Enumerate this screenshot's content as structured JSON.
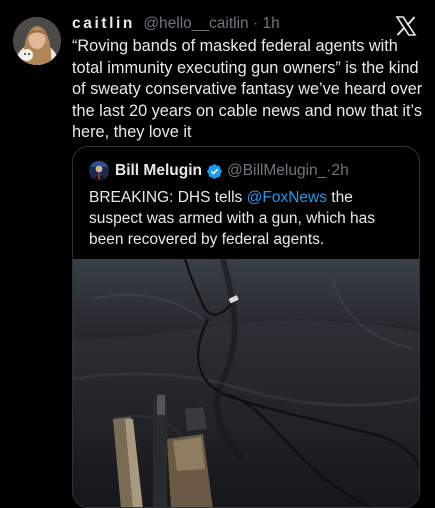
{
  "author": {
    "display_name": "caitlin",
    "handle": "@hello__caitlin",
    "separator": "·",
    "time": "1h",
    "avatar_icon": "profile-photo-avatar"
  },
  "tweet": {
    "text": "“Roving bands of masked federal agents with total immunity executing gun owners” is the kind of sweaty conservative fantasy we’ve heard over the last 20 years on cable news and now that it’s here, they love it"
  },
  "brand": {
    "logo_icon": "x-logo-icon"
  },
  "quote": {
    "display_name": "Bill Melugin",
    "verified_icon": "verified-badge-icon",
    "handle": "@BillMelugin_",
    "separator": "·",
    "time": "2h",
    "text_before": "BREAKING: DHS tells ",
    "mention": "@FoxNews",
    "text_after": " the suspect was armed with a gun, which has been recovered by federal agents.",
    "media_icon": "photo-car-seat-with-gun"
  },
  "colors": {
    "background": "#000000",
    "text": "#e7e9ea",
    "secondary_text": "#71767b",
    "link": "#1d9bf0",
    "border": "#2f3336"
  }
}
